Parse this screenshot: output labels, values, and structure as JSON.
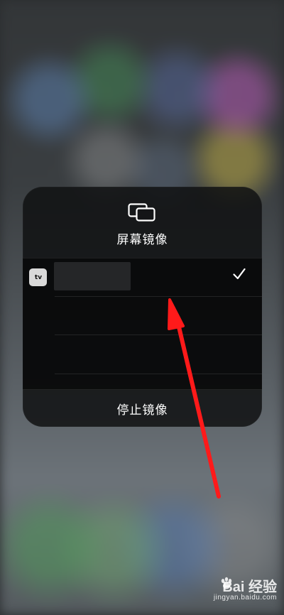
{
  "panel": {
    "icon": "screen-mirroring-icon",
    "title": "屏幕镜像"
  },
  "devices": [
    {
      "icon": "apple-tv-icon",
      "icon_label": "tv",
      "selected": true
    },
    {
      "icon": "",
      "selected": false
    },
    {
      "icon": "",
      "selected": false
    }
  ],
  "actions": {
    "stop_label": "停止镜像"
  },
  "annotation": {
    "arrow_color": "#ff0000"
  },
  "watermark": {
    "brand": "Bai 经验",
    "url": "jingyan.baidu.com"
  }
}
